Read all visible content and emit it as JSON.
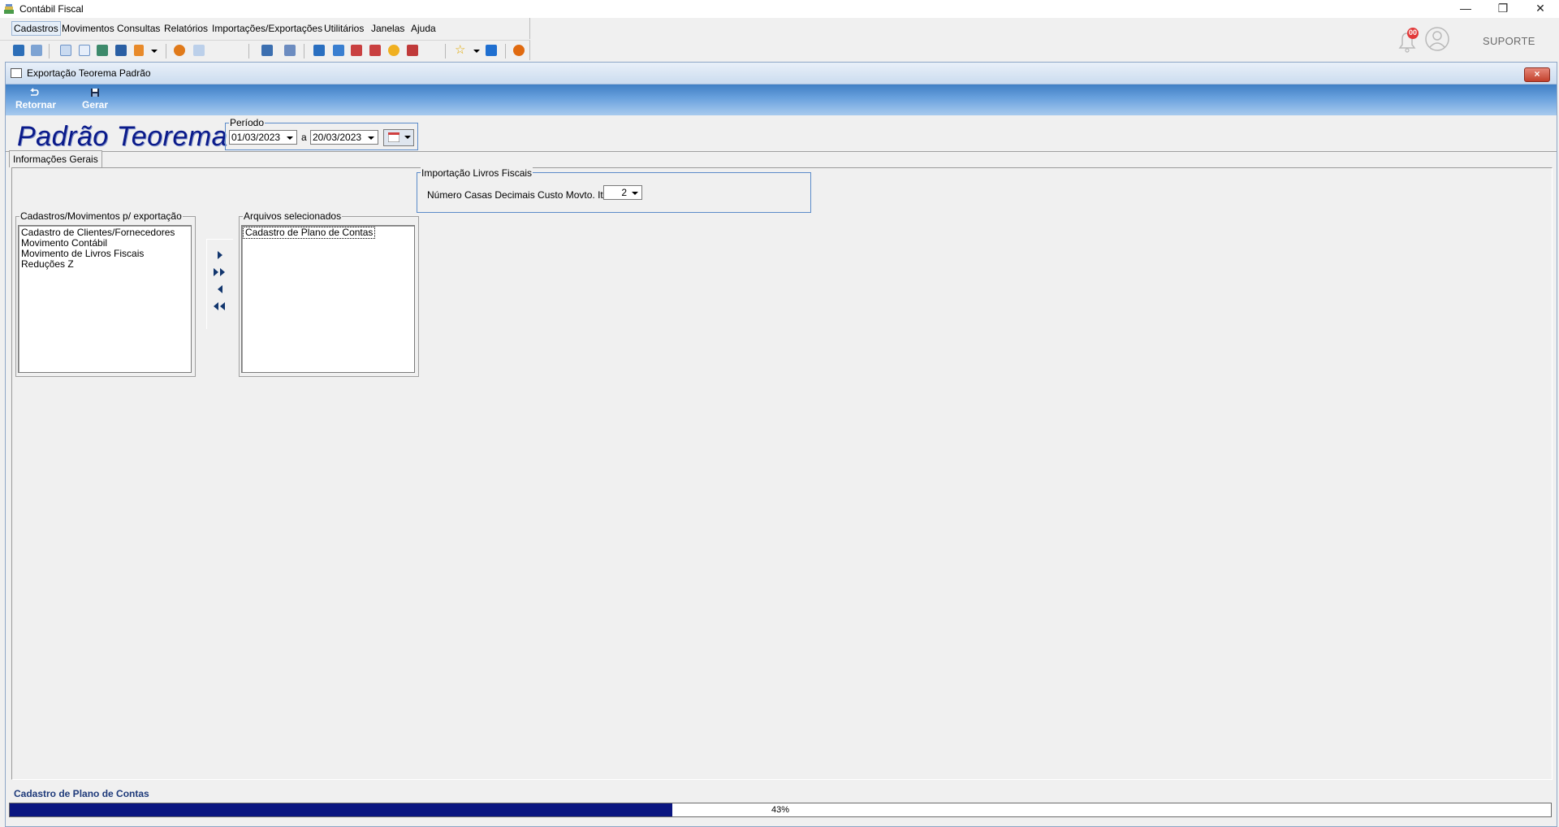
{
  "app": {
    "title": "Contábil Fiscal"
  },
  "menu": [
    "Cadastros",
    "Movimentos",
    "Consultas",
    "Relatórios",
    "Importações/Exportações",
    "Utilitários",
    "Janelas",
    "Ajuda"
  ],
  "header_right": {
    "notification_count": "00",
    "support_label": "SUPORTE"
  },
  "window": {
    "title": "Exportação Teorema Padrão",
    "close_label": "×",
    "actions": [
      {
        "label": "Retornar",
        "icon": "return-icon"
      },
      {
        "label": "Gerar",
        "icon": "save-icon"
      }
    ],
    "brand": "Padrão Teorema"
  },
  "periodo": {
    "label": "Período",
    "start": "01/03/2023",
    "separator": "a",
    "end": "20/03/2023"
  },
  "tab": "Informações Gerais",
  "livros": {
    "label": "Importação Livros Fiscais",
    "field_label": "Número Casas Decimais Custo Movto. Itens",
    "value": "2"
  },
  "available": {
    "label": "Cadastros/Movimentos p/ exportação",
    "items": [
      "Cadastro de Clientes/Fornecedores",
      "Movimento Contábil",
      "Movimento de Livros Fiscais",
      "Reduções Z"
    ]
  },
  "selected": {
    "label": "Arquivos selecionados",
    "items": [
      "Cadastro de Plano de Contas"
    ]
  },
  "status": {
    "text": "Cadastro de Plano de Contas",
    "progress": 0.43,
    "progress_label": "43%"
  },
  "colors": {
    "ribbon": "#3f7fc4",
    "progress": "#0a1580",
    "brand": "#0a1a8a",
    "group_border": "#5b8bc9"
  }
}
